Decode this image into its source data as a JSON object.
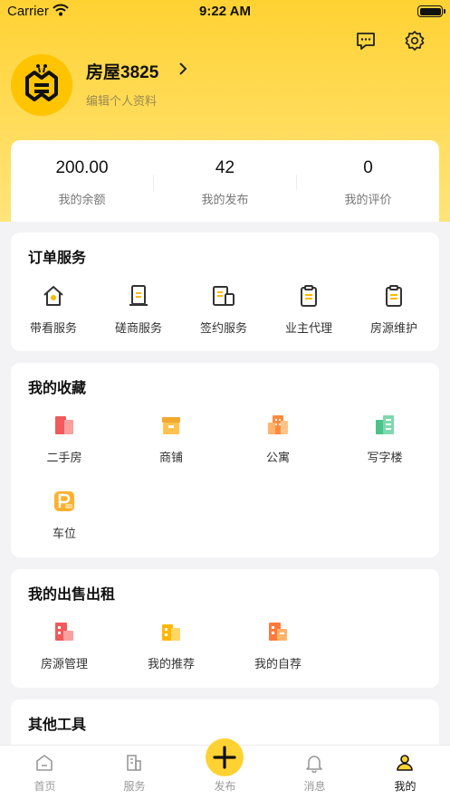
{
  "status_bar": {
    "carrier": "Carrier",
    "time": "9:22 AM"
  },
  "profile": {
    "name": "房屋3825",
    "edit_label": "编辑个人资料"
  },
  "stats": [
    {
      "value": "200.00",
      "label": "我的余额"
    },
    {
      "value": "42",
      "label": "我的发布"
    },
    {
      "value": "0",
      "label": "我的评价"
    }
  ],
  "order_services": {
    "title": "订单服务",
    "items": [
      {
        "label": "带看服务",
        "icon": "house-icon"
      },
      {
        "label": "磋商服务",
        "icon": "document-icon"
      },
      {
        "label": "签约服务",
        "icon": "contract-icon"
      },
      {
        "label": "业主代理",
        "icon": "clipboard-icon"
      },
      {
        "label": "房源维护",
        "icon": "clipboard-icon"
      }
    ]
  },
  "favorites": {
    "title": "我的收藏",
    "items": [
      {
        "label": "二手房",
        "icon": "second-hand-house-icon"
      },
      {
        "label": "商铺",
        "icon": "shop-icon"
      },
      {
        "label": "公寓",
        "icon": "apartment-icon"
      },
      {
        "label": "写字楼",
        "icon": "office-building-icon"
      },
      {
        "label": "车位",
        "icon": "parking-icon"
      }
    ]
  },
  "sales": {
    "title": "我的出售出租",
    "items": [
      {
        "label": "房源管理",
        "icon": "listing-management-icon"
      },
      {
        "label": "我的推荐",
        "icon": "recommend-icon"
      },
      {
        "label": "我的自荐",
        "icon": "self-recommend-icon"
      }
    ]
  },
  "tools": {
    "title": "其他工具"
  },
  "tabbar": {
    "active": "我的",
    "tabs": [
      {
        "label": "首页",
        "icon": "home-icon"
      },
      {
        "label": "服务",
        "icon": "building-icon"
      },
      {
        "label": "发布",
        "icon": "plus-icon"
      },
      {
        "label": "消息",
        "icon": "bell-icon"
      },
      {
        "label": "我的",
        "icon": "user-icon"
      }
    ]
  },
  "colors": {
    "brand_yellow": "#ffd233",
    "background": "#f3f3f5",
    "muted_text": "#777777"
  }
}
